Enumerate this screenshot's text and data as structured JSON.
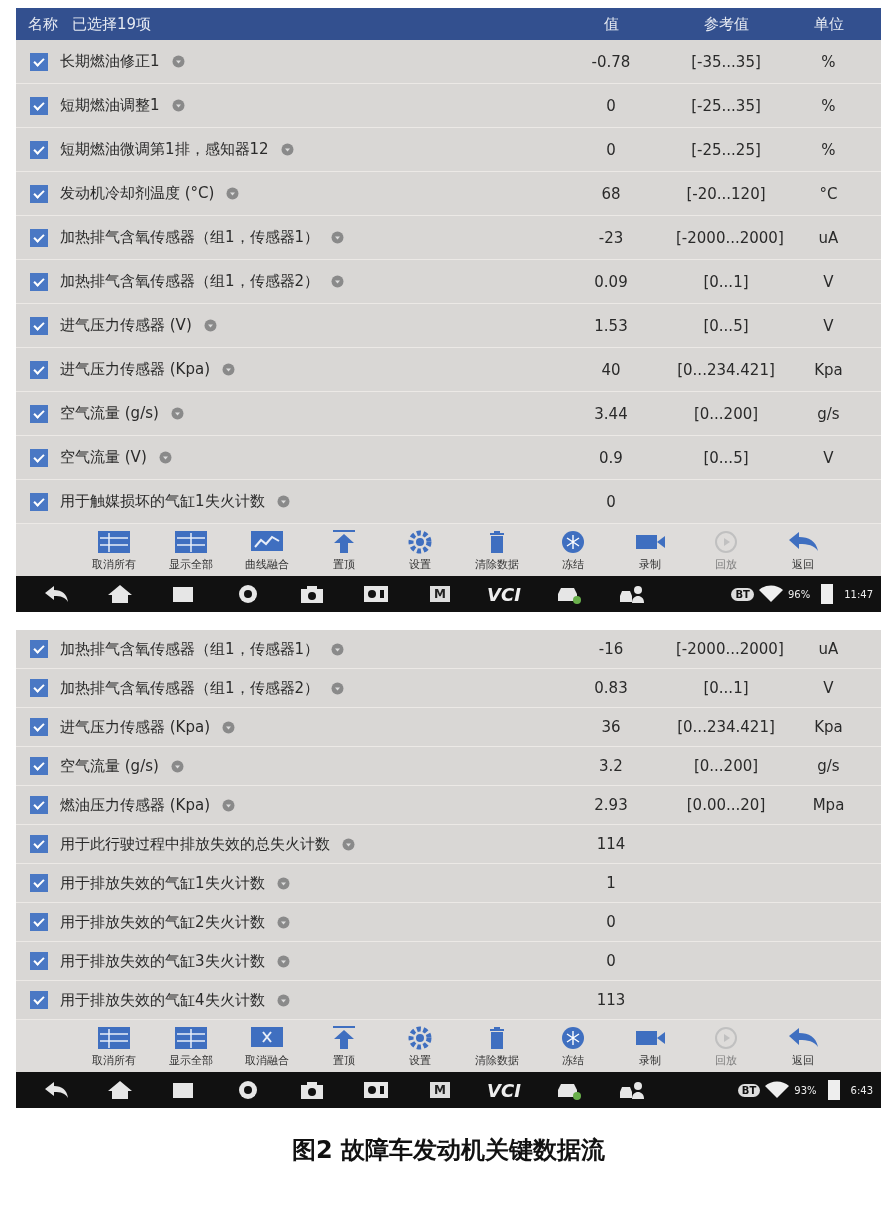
{
  "screens": [
    {
      "header": {
        "name": "名称",
        "selected_count": "已选择19项",
        "value": "值",
        "reference": "参考值",
        "unit": "单位"
      },
      "rows": [
        {
          "checked": true,
          "name": "长期燃油修正1",
          "value": "-0.78",
          "reference": "[-35...35]",
          "unit": "%"
        },
        {
          "checked": true,
          "name": "短期燃油调整1",
          "value": "0",
          "reference": "[-25...35]",
          "unit": "%"
        },
        {
          "checked": true,
          "name": "短期燃油微调第1排，感知器12",
          "value": "0",
          "reference": "[-25...25]",
          "unit": "%"
        },
        {
          "checked": true,
          "name": "发动机冷却剂温度 (°C)",
          "value": "68",
          "reference": "[-20...120]",
          "unit": "°C"
        },
        {
          "checked": true,
          "name": "加热排气含氧传感器（组1，传感器1）",
          "value": "-23",
          "reference": "[-2000...2000]",
          "unit": "uA"
        },
        {
          "checked": true,
          "name": "加热排气含氧传感器（组1，传感器2）",
          "value": "0.09",
          "reference": "[0...1]",
          "unit": "V"
        },
        {
          "checked": true,
          "name": "进气压力传感器 (V)",
          "value": "1.53",
          "reference": "[0...5]",
          "unit": "V"
        },
        {
          "checked": true,
          "name": "进气压力传感器 (Kpa)",
          "value": "40",
          "reference": "[0...234.421]",
          "unit": "Kpa"
        },
        {
          "checked": true,
          "name": "空气流量 (g/s)",
          "value": "3.44",
          "reference": "[0...200]",
          "unit": "g/s"
        },
        {
          "checked": true,
          "name": "空气流量 (V)",
          "value": "0.9",
          "reference": "[0...5]",
          "unit": "V"
        },
        {
          "checked": true,
          "name": "用于触媒损坏的气缸1失火计数",
          "value": "0",
          "reference": "",
          "unit": ""
        }
      ],
      "toolbar": [
        {
          "kind": "deselect",
          "label": "取消所有",
          "disabled": false
        },
        {
          "kind": "showall",
          "label": "显示全部",
          "disabled": false
        },
        {
          "kind": "merge",
          "label": "曲线融合",
          "disabled": false
        },
        {
          "kind": "top",
          "label": "置顶",
          "disabled": false
        },
        {
          "kind": "settings",
          "label": "设置",
          "disabled": false
        },
        {
          "kind": "clear",
          "label": "清除数据",
          "disabled": false
        },
        {
          "kind": "freeze",
          "label": "冻结",
          "disabled": false
        },
        {
          "kind": "record",
          "label": "录制",
          "disabled": false
        },
        {
          "kind": "play",
          "label": "回放",
          "disabled": true
        },
        {
          "kind": "back",
          "label": "返回",
          "disabled": false
        }
      ],
      "navbar": {
        "m": "M",
        "vci": "VCI",
        "bt": "BT",
        "battery": "96%",
        "time": "11:47"
      }
    },
    {
      "rows": [
        {
          "checked": true,
          "name": "加热排气含氧传感器（组1，传感器1）",
          "value": "-16",
          "reference": "[-2000...2000]",
          "unit": "uA"
        },
        {
          "checked": true,
          "name": "加热排气含氧传感器（组1，传感器2）",
          "value": "0.83",
          "reference": "[0...1]",
          "unit": "V"
        },
        {
          "checked": true,
          "name": "进气压力传感器 (Kpa)",
          "value": "36",
          "reference": "[0...234.421]",
          "unit": "Kpa"
        },
        {
          "checked": true,
          "name": "空气流量 (g/s)",
          "value": "3.2",
          "reference": "[0...200]",
          "unit": "g/s"
        },
        {
          "checked": true,
          "name": "燃油压力传感器 (Kpa)",
          "value": "2.93",
          "reference": "[0.00...20]",
          "unit": "Mpa"
        },
        {
          "checked": true,
          "name": "用于此行驶过程中排放失效的总失火计数",
          "value": "114",
          "reference": "",
          "unit": ""
        },
        {
          "checked": true,
          "name": "用于排放失效的气缸1失火计数",
          "value": "1",
          "reference": "",
          "unit": ""
        },
        {
          "checked": true,
          "name": "用于排放失效的气缸2失火计数",
          "value": "0",
          "reference": "",
          "unit": ""
        },
        {
          "checked": true,
          "name": "用于排放失效的气缸3失火计数",
          "value": "0",
          "reference": "",
          "unit": ""
        },
        {
          "checked": true,
          "name": "用于排放失效的气缸4失火计数",
          "value": "113",
          "reference": "",
          "unit": ""
        }
      ],
      "toolbar": [
        {
          "kind": "deselect",
          "label": "取消所有",
          "disabled": false
        },
        {
          "kind": "showall",
          "label": "显示全部",
          "disabled": false
        },
        {
          "kind": "unmerge",
          "label": "取消融合",
          "disabled": false
        },
        {
          "kind": "top",
          "label": "置顶",
          "disabled": false
        },
        {
          "kind": "settings",
          "label": "设置",
          "disabled": false
        },
        {
          "kind": "clear",
          "label": "清除数据",
          "disabled": false
        },
        {
          "kind": "freeze",
          "label": "冻结",
          "disabled": false
        },
        {
          "kind": "record",
          "label": "录制",
          "disabled": false
        },
        {
          "kind": "play",
          "label": "回放",
          "disabled": true
        },
        {
          "kind": "back",
          "label": "返回",
          "disabled": false
        }
      ],
      "navbar": {
        "m": "M",
        "vci": "VCI",
        "bt": "BT",
        "battery": "93%",
        "time": "6:43"
      }
    }
  ],
  "caption": "图2 故障车发动机关键数据流"
}
